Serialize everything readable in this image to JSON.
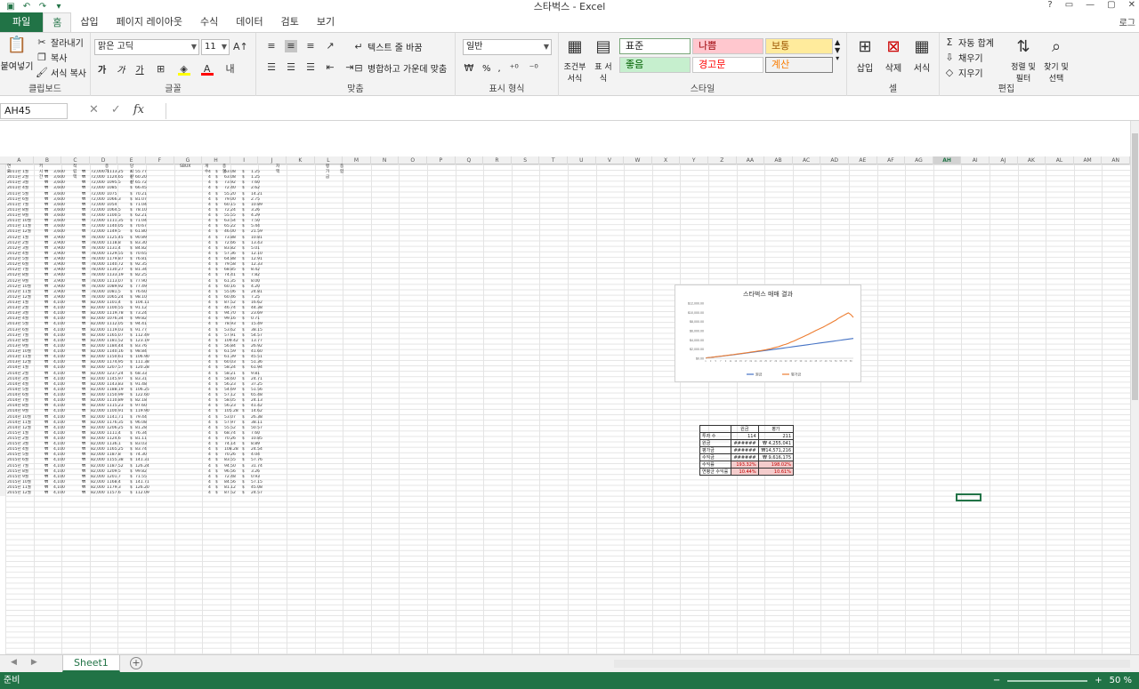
{
  "window": {
    "title": "스타벅스 - Excel",
    "user": "로그",
    "controls": [
      "?",
      "▭",
      "—",
      "▢",
      "✕"
    ]
  },
  "qat": {
    "save_icon": "save-icon",
    "undo_icon": "undo-icon",
    "redo_icon": "redo-icon"
  },
  "tabs": [
    {
      "label": "파일",
      "kind": "file"
    },
    {
      "label": "홈",
      "kind": "active"
    },
    {
      "label": "삽입"
    },
    {
      "label": "페이지 레이아웃"
    },
    {
      "label": "수식"
    },
    {
      "label": "데이터"
    },
    {
      "label": "검토"
    },
    {
      "label": "보기"
    }
  ],
  "ribbon": {
    "clipboard": {
      "label": "클립보드",
      "paste": "붙여넣기",
      "cut": "잘라내기",
      "copy": "복사",
      "format_painter": "서식 복사"
    },
    "font": {
      "label": "글꼴",
      "font_name": "맑은 고딕",
      "font_size": "11",
      "bold": "가",
      "italic": "가",
      "underline": "가"
    },
    "alignment": {
      "label": "맞춤",
      "wrap": "텍스트 줄 바꿈",
      "merge": "병합하고 가운데 맞춤"
    },
    "number": {
      "label": "표시 형식",
      "format": "일반",
      "percent": "%",
      "comma": ","
    },
    "styles": {
      "label": "스타일",
      "conditional": "조건부 서식",
      "table": "표 서식",
      "cells": [
        {
          "name": "표준",
          "bg": "#ffffff",
          "fg": "#222222"
        },
        {
          "name": "나쁨",
          "bg": "#ffc7ce",
          "fg": "#9c0006"
        },
        {
          "name": "보통",
          "bg": "#ffeb9c",
          "fg": "#9c5700"
        },
        {
          "name": "좋음",
          "bg": "#c6efce",
          "fg": "#006100"
        },
        {
          "name": "경고문",
          "bg": "#ffffff",
          "fg": "#ff0000"
        },
        {
          "name": "계산",
          "bg": "#f2f2f2",
          "fg": "#fa7d00"
        }
      ]
    },
    "cells": {
      "label": "셀",
      "insert": "삽입",
      "delete": "삭제",
      "format": "서식"
    },
    "editing": {
      "label": "편집",
      "autosum": "자동 합계",
      "fill": "채우기",
      "clear": "지우기",
      "sort": "정렬 및 필터",
      "find": "찾기 및 선택"
    }
  },
  "formula_bar": {
    "name_box": "AH45",
    "fx": "fx",
    "cancel": "✕",
    "confirm": "✓"
  },
  "sheet": {
    "columns": [
      "A",
      "B",
      "C",
      "D",
      "E",
      "F",
      "G",
      "H",
      "I",
      "J",
      "K",
      "L",
      "M",
      "N",
      "O",
      "P",
      "Q",
      "R",
      "S",
      "T",
      "U",
      "V",
      "W",
      "X",
      "Y",
      "Z",
      "AA",
      "AB",
      "AC",
      "AD",
      "AE",
      "AF",
      "AG",
      "AH",
      "AI",
      "AJ",
      "AK",
      "AL",
      "AM",
      "AN"
    ],
    "selected_column": "AH",
    "header": [
      "연도",
      "키시간",
      "적립액",
      "종가",
      "당시 잔산",
      "SBUX",
      "개수",
      "종합",
      "",
      "차액",
      "",
      "종합",
      "평가금"
    ],
    "rows": [
      [
        "2011년 1월",
        "₩",
        "3,600",
        "₩",
        "72,000",
        "1113.25",
        "$",
        "55.77",
        "4",
        "$",
        "63.08",
        "$",
        "1.25"
      ],
      [
        "2011년 2월",
        "₩",
        "3,600",
        "₩",
        "72,000",
        "1124.65",
        "$",
        "60.20",
        "4",
        "$",
        "63.08",
        "$",
        "1.25"
      ],
      [
        "2011년 3월",
        "₩",
        "3,600",
        "₩",
        "72,000",
        "1095.5",
        "$",
        "65.72",
        "4",
        "$",
        "73.92",
        "$",
        "7.60"
      ],
      [
        "2011년 4월",
        "₩",
        "3,600",
        "₩",
        "72,000",
        "1085",
        "$",
        "66.45",
        "4",
        "$",
        "72.40",
        "$",
        "2.62"
      ],
      [
        "2011년 5월",
        "₩",
        "3,600",
        "₩",
        "72,000",
        "1075",
        "$",
        "70.21",
        "4",
        "$",
        "55.20",
        "$",
        "14.21"
      ],
      [
        "2011년 6월",
        "₩",
        "3,600",
        "₩",
        "72,000",
        "1066.3",
        "$",
        "81.07",
        "4",
        "$",
        "79.00",
        "$",
        "2.75"
      ],
      [
        "2011년 7월",
        "₩",
        "3,600",
        "₩",
        "72,000",
        "1054",
        "$",
        "71.04",
        "4",
        "$",
        "60.15",
        "$",
        "10.89"
      ],
      [
        "2011년 8월",
        "₩",
        "3,600",
        "₩",
        "72,000",
        "1064.5",
        "$",
        "78.10",
        "4",
        "$",
        "72.24",
        "$",
        "3.26"
      ],
      [
        "2011년 9월",
        "₩",
        "3,600",
        "₩",
        "72,000",
        "1100.5",
        "$",
        "62.21",
        "4",
        "$",
        "55.55",
        "$",
        "4.29"
      ],
      [
        "2011년 10월",
        "₩",
        "3,600",
        "₩",
        "72,000",
        "1111.35",
        "$",
        "71.04",
        "4",
        "$",
        "63.54",
        "$",
        "7.50"
      ],
      [
        "2011년 11월",
        "₩",
        "3,600",
        "₩",
        "72,000",
        "1140.05",
        "$",
        "70.67",
        "4",
        "$",
        "65.22",
        "$",
        "5.44"
      ],
      [
        "2011년 12월",
        "₩",
        "3,600",
        "₩",
        "72,000",
        "1149.5",
        "$",
        "61.80",
        "4",
        "$",
        "46.00",
        "$",
        "21.59"
      ],
      [
        "2012년 1월",
        "₩",
        "3,900",
        "₩",
        "78,000",
        "1125.45",
        "$",
        "90.89",
        "4",
        "$",
        "73.88",
        "$",
        "10.81"
      ],
      [
        "2012년 2월",
        "₩",
        "3,900",
        "₩",
        "78,000",
        "1118.8",
        "$",
        "83.30",
        "4",
        "$",
        "72.66",
        "$",
        "13.43"
      ],
      [
        "2012년 3월",
        "₩",
        "3,900",
        "₩",
        "78,000",
        "1131.4",
        "$",
        "84.82",
        "4",
        "$",
        "83.82",
        "$",
        "5.01"
      ],
      [
        "2012년 4월",
        "₩",
        "3,900",
        "₩",
        "78,000",
        "1129.55",
        "$",
        "70.65",
        "4",
        "$",
        "57.36",
        "$",
        "12.10"
      ],
      [
        "2012년 5월",
        "₩",
        "3,900",
        "₩",
        "78,000",
        "1179.87",
        "$",
        "76.81",
        "4",
        "$",
        "64.88",
        "$",
        "12.91"
      ],
      [
        "2012년 6월",
        "₩",
        "3,900",
        "₩",
        "78,000",
        "1140.72",
        "$",
        "92.35",
        "4",
        "$",
        "79.58",
        "$",
        "12.33"
      ],
      [
        "2012년 7월",
        "₩",
        "3,900",
        "₩",
        "78,000",
        "1130.27",
        "$",
        "81.34",
        "4",
        "$",
        "68.85",
        "$",
        "8.42"
      ],
      [
        "2012년 8월",
        "₩",
        "3,900",
        "₩",
        "78,000",
        "1133.19",
        "$",
        "82.25",
        "4",
        "$",
        "74.41",
        "$",
        "7.82"
      ],
      [
        "2012년 9월",
        "₩",
        "3,900",
        "₩",
        "78,000",
        "1113.07",
        "$",
        "77.90",
        "4",
        "$",
        "61.35",
        "$",
        "8.00"
      ],
      [
        "2012년 10월",
        "₩",
        "3,900",
        "₩",
        "78,000",
        "1089.92",
        "$",
        "77.49",
        "4",
        "$",
        "60.16",
        "$",
        "4.20"
      ],
      [
        "2012년 11월",
        "₩",
        "3,900",
        "₩",
        "78,000",
        "1081.5",
        "$",
        "76.60",
        "4",
        "$",
        "55.06",
        "$",
        "24.81"
      ],
      [
        "2012년 12월",
        "₩",
        "3,900",
        "₩",
        "78,000",
        "1065.24",
        "$",
        "98.10",
        "4",
        "$",
        "60.46",
        "$",
        "7.25"
      ],
      [
        "2013년 1월",
        "₩",
        "4,100",
        "₩",
        "82,000",
        "1101.4",
        "$",
        "104.11",
        "4",
        "$",
        "87.52",
        "$",
        "16.62"
      ],
      [
        "2013년 2월",
        "₩",
        "4,100",
        "₩",
        "82,000",
        "1100.55",
        "$",
        "91.12",
        "4",
        "$",
        "46.74",
        "$",
        "44.38"
      ],
      [
        "2013년 3월",
        "₩",
        "4,100",
        "₩",
        "82,000",
        "1119.78",
        "$",
        "73.24",
        "4",
        "$",
        "94.70",
        "$",
        "23.69"
      ],
      [
        "2013년 4월",
        "₩",
        "4,100",
        "₩",
        "82,000",
        "1076.34",
        "$",
        "99.82",
        "4",
        "$",
        "99.16",
        "$",
        "0.71"
      ],
      [
        "2013년 5월",
        "₩",
        "4,100",
        "₩",
        "82,000",
        "1112.05",
        "$",
        "94.41",
        "4",
        "$",
        "78.93",
        "$",
        "15.49"
      ],
      [
        "2013년 6월",
        "₩",
        "4,100",
        "₩",
        "82,000",
        "1119.03",
        "$",
        "91.77",
        "4",
        "$",
        "53.62",
        "$",
        "38.15"
      ],
      [
        "2013년 7월",
        "₩",
        "4,100",
        "₩",
        "82,000",
        "1165.07",
        "$",
        "112.49",
        "4",
        "$",
        "57.91",
        "$",
        "54.57"
      ],
      [
        "2013년 8월",
        "₩",
        "4,100",
        "₩",
        "82,000",
        "1181.52",
        "$",
        "123.19",
        "4",
        "$",
        "109.42",
        "$",
        "13.77"
      ],
      [
        "2013년 9월",
        "₩",
        "4,100",
        "₩",
        "82,000",
        "1184.44",
        "$",
        "83.76",
        "4",
        "$",
        "56.84",
        "$",
        "26.92"
      ],
      [
        "2013년 10월",
        "₩",
        "4,100",
        "₩",
        "82,000",
        "1140.16",
        "$",
        "98.84",
        "4",
        "$",
        "61.59",
        "$",
        "41.60"
      ],
      [
        "2013년 11월",
        "₩",
        "4,100",
        "₩",
        "82,000",
        "1150.61",
        "$",
        "106.90",
        "4",
        "$",
        "61.39",
        "$",
        "45.51"
      ],
      [
        "2013년 12월",
        "₩",
        "4,100",
        "₩",
        "82,000",
        "1174.95",
        "$",
        "111.38",
        "4",
        "$",
        "60.03",
        "$",
        "51.36"
      ],
      [
        "2014년 1월",
        "₩",
        "4,100",
        "₩",
        "82,000",
        "1207.57",
        "$",
        "120.28",
        "4",
        "$",
        "58.24",
        "$",
        "61.94"
      ],
      [
        "2014년 2월",
        "₩",
        "4,100",
        "₩",
        "82,000",
        "1237.24",
        "$",
        "68.33",
        "4",
        "$",
        "58.21",
        "$",
        "9.81"
      ],
      [
        "2014년 3월",
        "₩",
        "4,100",
        "₩",
        "82,000",
        "1145.97",
        "$",
        "83.31",
        "4",
        "$",
        "58.60",
        "$",
        "24.71"
      ],
      [
        "2014년 4월",
        "₩",
        "4,100",
        "₩",
        "82,000",
        "1143.83",
        "$",
        "91.48",
        "4",
        "$",
        "56.23",
        "$",
        "37.25"
      ],
      [
        "2014년 5월",
        "₩",
        "4,100",
        "₩",
        "82,000",
        "1188.19",
        "$",
        "106.25",
        "4",
        "$",
        "54.69",
        "$",
        "51.56"
      ],
      [
        "2014년 6월",
        "₩",
        "4,100",
        "₩",
        "82,000",
        "1150.99",
        "$",
        "122.60",
        "4",
        "$",
        "57.12",
        "$",
        "65.48"
      ],
      [
        "2014년 7월",
        "₩",
        "4,100",
        "₩",
        "82,000",
        "1110.89",
        "$",
        "82.18",
        "4",
        "$",
        "58.05",
        "$",
        "24.13"
      ],
      [
        "2014년 8월",
        "₩",
        "4,100",
        "₩",
        "82,000",
        "1115.23",
        "$",
        "97.60",
        "4",
        "$",
        "56.23",
        "$",
        "41.42"
      ],
      [
        "2014년 9월",
        "₩",
        "4,100",
        "₩",
        "82,000",
        "1100.91",
        "$",
        "119.90",
        "4",
        "$",
        "105.28",
        "$",
        "14.62"
      ],
      [
        "2014년 10월",
        "₩",
        "4,100",
        "₩",
        "82,000",
        "1141.71",
        "$",
        "79.44",
        "4",
        "$",
        "53.07",
        "$",
        "26.38"
      ],
      [
        "2014년 11월",
        "₩",
        "4,100",
        "₩",
        "82,000",
        "1176.35",
        "$",
        "96.08",
        "4",
        "$",
        "57.97",
        "$",
        "38.11"
      ],
      [
        "2014년 12월",
        "₩",
        "4,100",
        "₩",
        "82,000",
        "1206.25",
        "$",
        "81.28",
        "4",
        "$",
        "55.52",
        "$",
        "50.57"
      ],
      [
        "2015년 1월",
        "₩",
        "4,100",
        "₩",
        "82,000",
        "1111.4",
        "$",
        "76.34",
        "4",
        "$",
        "68.74",
        "$",
        "7.60"
      ],
      [
        "2015년 2월",
        "₩",
        "4,100",
        "₩",
        "82,000",
        "1124.6",
        "$",
        "81.11",
        "4",
        "$",
        "70.26",
        "$",
        "10.85"
      ],
      [
        "2015년 3월",
        "₩",
        "4,100",
        "₩",
        "82,000",
        "1136.1",
        "$",
        "83.03",
        "4",
        "$",
        "74.14",
        "$",
        "8.89"
      ],
      [
        "2015년 4월",
        "₩",
        "4,100",
        "₩",
        "82,000",
        "1165.25",
        "$",
        "83.74",
        "4",
        "$",
        "108.28",
        "$",
        "24.54"
      ],
      [
        "2015년 5월",
        "₩",
        "4,100",
        "₩",
        "82,000",
        "1187.8",
        "$",
        "74.30",
        "4",
        "$",
        "70.26",
        "$",
        "4.04"
      ],
      [
        "2015년 6월",
        "₩",
        "4,100",
        "₩",
        "82,000",
        "1155.38",
        "$",
        "141.31",
        "4",
        "$",
        "83.55",
        "$",
        "57.76"
      ],
      [
        "2015년 7월",
        "₩",
        "4,100",
        "₩",
        "82,000",
        "1187.52",
        "$",
        "126.24",
        "4",
        "$",
        "94.50",
        "$",
        "31.74"
      ],
      [
        "2015년 8월",
        "₩",
        "4,100",
        "₩",
        "82,000",
        "1209.5",
        "$",
        "99.82",
        "4",
        "$",
        "96.56",
        "$",
        "3.26"
      ],
      [
        "2015년 9월",
        "₩",
        "4,100",
        "₩",
        "82,000",
        "1201.7",
        "$",
        "71.55",
        "4",
        "$",
        "72.48",
        "$",
        "0.93"
      ],
      [
        "2015년 10월",
        "₩",
        "4,100",
        "₩",
        "82,000",
        "1168.4",
        "$",
        "141.71",
        "4",
        "$",
        "84.56",
        "$",
        "57.15"
      ],
      [
        "2015년 11월",
        "₩",
        "4,100",
        "₩",
        "82,000",
        "1179.3",
        "$",
        "126.20",
        "4",
        "$",
        "81.12",
        "$",
        "45.08"
      ],
      [
        "2015년 12월",
        "₩",
        "4,100",
        "₩",
        "82,000",
        "1157.6",
        "$",
        "112.09",
        "4",
        "$",
        "87.52",
        "$",
        "24.57"
      ]
    ]
  },
  "chart_data": {
    "type": "line",
    "title": "스타벅스 매매 결과",
    "x": [
      1,
      2,
      3,
      4,
      5,
      6,
      7,
      8,
      9,
      10,
      11,
      12,
      13,
      14,
      15,
      16,
      17,
      18,
      19,
      20,
      21,
      22,
      23,
      24,
      25,
      26,
      27,
      28,
      29,
      30,
      31,
      32,
      33,
      34,
      35,
      36,
      37,
      38,
      39,
      40,
      41,
      42,
      43,
      44,
      45,
      46,
      47,
      48,
      49,
      50,
      51,
      52,
      53,
      54,
      55,
      56,
      57,
      58,
      59,
      60
    ],
    "series": [
      {
        "name": "원금",
        "color": "#4472c4",
        "values": [
          63,
          126,
          189,
          252,
          315,
          378,
          441,
          504,
          567,
          630,
          693,
          756,
          828,
          900,
          972,
          1044,
          1116,
          1188,
          1260,
          1332,
          1404,
          1476,
          1548,
          1620,
          1695,
          1770,
          1845,
          1920,
          1995,
          2070,
          2145,
          2220,
          2295,
          2370,
          2445,
          2520,
          2595,
          2670,
          2745,
          2820,
          2895,
          2970,
          3045,
          3120,
          3195,
          3270,
          3345,
          3420,
          3495,
          3570,
          3645,
          3720,
          3795,
          3870,
          3945,
          4020,
          4095,
          4170,
          4245,
          4320
        ]
      },
      {
        "name": "평가금",
        "color": "#ed7d31",
        "values": [
          64,
          130,
          195,
          262,
          330,
          400,
          458,
          525,
          590,
          660,
          730,
          800,
          880,
          950,
          1020,
          1100,
          1180,
          1260,
          1340,
          1420,
          1500,
          1580,
          1660,
          1750,
          1850,
          1980,
          2100,
          2240,
          2380,
          2520,
          2700,
          2900,
          3050,
          3250,
          3500,
          3700,
          3950,
          4200,
          4450,
          4700,
          4950,
          5200,
          5500,
          5750,
          6050,
          6300,
          6550,
          6800,
          7100,
          7400,
          7700,
          8000,
          8300,
          8700,
          9000,
          9300,
          9600,
          9900,
          9500,
          8900
        ]
      }
    ],
    "y_ticks": [
      "$12,000.00",
      "$10,000.00",
      "$8,000.00",
      "$6,000.00",
      "$4,000.00",
      "$2,000.00",
      "$0.00"
    ],
    "ylim": [
      0,
      12000
    ],
    "legend": "bottom"
  },
  "summary": {
    "headers": [
      "",
      "원금",
      "평가"
    ],
    "rows": [
      {
        "label": "투자 수",
        "a": "114",
        "b": "211"
      },
      {
        "label": "원금",
        "a": "######",
        "b": "₩ 4,255,041"
      },
      {
        "label": "평가금",
        "a": "######",
        "b": "₩14,571,216"
      },
      {
        "label": "수익금",
        "a": "######",
        "b": "₩ 9,616,175"
      },
      {
        "label": "수익률",
        "a": "193.32%",
        "b": "198.02%",
        "highlight": true
      },
      {
        "label": "연평균 수익률",
        "a": "10.44%",
        "b": "10.61%",
        "highlight": true
      }
    ]
  },
  "sheet_tabs": {
    "active": "Sheet1",
    "add": "+"
  },
  "status": {
    "mode": "준비",
    "zoom": "50 %"
  }
}
